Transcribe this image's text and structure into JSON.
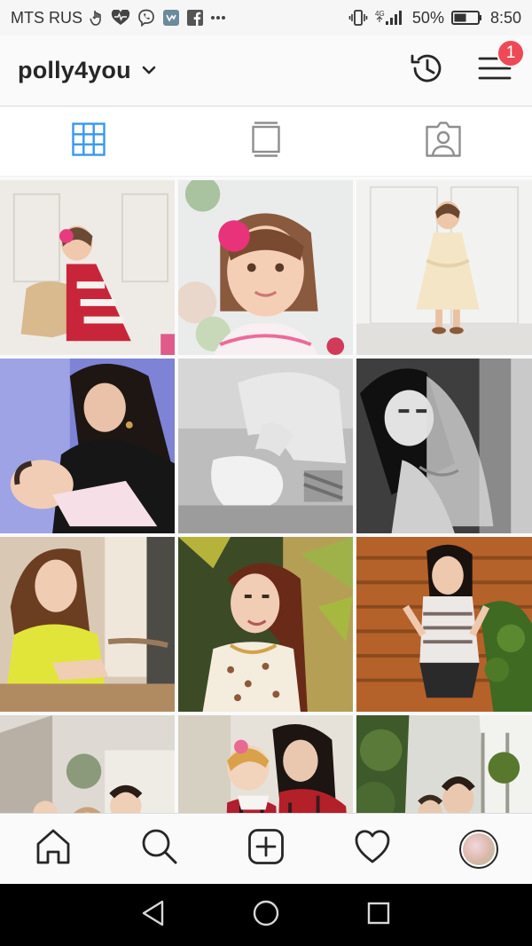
{
  "status_bar": {
    "carrier": "MTS RUS",
    "network": "4G",
    "battery_percent": "50%",
    "time": "8:50"
  },
  "header": {
    "username": "polly4you",
    "notification_count": "1",
    "icons": [
      "chevron-down-icon",
      "history-icon",
      "menu-icon"
    ]
  },
  "tabs": [
    {
      "icon": "grid-icon",
      "active": true
    },
    {
      "icon": "feed-icon",
      "active": false
    },
    {
      "icon": "tagged-icon",
      "active": false
    }
  ],
  "grid": {
    "rows": 4,
    "columns": 3,
    "photo_count_visible": 12
  },
  "bottom_nav": {
    "items": [
      "home-icon",
      "search-icon",
      "add-post-icon",
      "activity-heart-icon",
      "profile-avatar"
    ]
  },
  "android_nav": {
    "items": [
      "back-icon",
      "home-circle-icon",
      "recents-icon"
    ]
  },
  "colors": {
    "accent_blue": "#3897f0",
    "badge_red": "#ed4956",
    "text": "#262626"
  }
}
